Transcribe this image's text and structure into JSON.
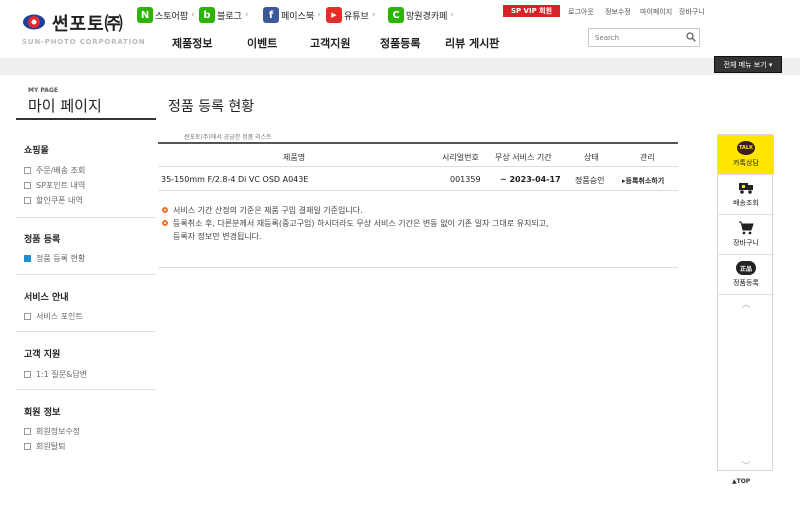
{
  "brand": {
    "name": "썬포토㈜",
    "sub": "SUN-PHOTO CORPORATION"
  },
  "social": [
    {
      "label": "스토어팜",
      "icon": "store-farm-icon",
      "glyph": "N",
      "color": "#2db400"
    },
    {
      "label": "블로그",
      "icon": "blog-icon",
      "glyph": "b",
      "color": "#2db400"
    },
    {
      "label": "페이스북",
      "icon": "facebook-icon",
      "glyph": "f",
      "color": "#3b5998"
    },
    {
      "label": "유튜브",
      "icon": "youtube-icon",
      "glyph": "▶",
      "color": "#e52d27"
    },
    {
      "label": "망원경카페",
      "icon": "cafe-icon",
      "glyph": "C",
      "color": "#2db400"
    }
  ],
  "top_links": {
    "vip": "SP VIP 회원",
    "login": "로그아웃",
    "info_edit": "정보수정",
    "mypage": "마이페이지",
    "cart": "장바구니"
  },
  "gnb": [
    "제품정보",
    "이벤트",
    "고객지원",
    "정품등록",
    "리뷰 게시판"
  ],
  "search": {
    "placeholder": "Search"
  },
  "all_menu": "전체 메뉴 보기 ▾",
  "mypage": {
    "small": "MY PAGE",
    "title": "마이 페이지"
  },
  "page_title": "정품 등록 현황",
  "sidebar": [
    {
      "head": "쇼핑몰",
      "items": [
        {
          "label": "주문/배송 조회",
          "active": false
        },
        {
          "label": "SP포인트 내역",
          "active": false
        },
        {
          "label": "할인쿠폰 내역",
          "active": false
        }
      ]
    },
    {
      "head": "정품 등록",
      "items": [
        {
          "label": "정품 등록 현황",
          "active": true
        }
      ]
    },
    {
      "head": "서비스 안내",
      "items": [
        {
          "label": "서비스 포인트",
          "active": false
        }
      ]
    },
    {
      "head": "고객 지원",
      "items": [
        {
          "label": "1:1 질문&답변",
          "active": false
        }
      ]
    },
    {
      "head": "회원 정보",
      "items": [
        {
          "label": "회원정보수정",
          "active": false
        },
        {
          "label": "회원탈퇴",
          "active": false
        }
      ]
    }
  ],
  "table": {
    "caption": "썬포토(주)에서 공급한 정품 리스트",
    "headers": [
      "제품명",
      "시리얼번호",
      "무상 서비스 기간",
      "상태",
      "관리"
    ],
    "rows": [
      {
        "product": "35-150mm F/2.8-4 Di VC OSD A043E",
        "serial": "001359",
        "period": "~ 2023-04-17",
        "status": "정품승인",
        "action": "▸등록취소하기"
      }
    ]
  },
  "notes": [
    "서비스 기간 산정의 기준은 제품 구입 결제일 기준입니다.",
    "등록취소 후, 다른분께서 재등록(중고구입) 하시더라도 무상 서비스 기간은 변동 없이 기존 일자 그대로 유지되고,",
    "등록자 정보만 변경됩니다."
  ],
  "quick_menu": {
    "kakao": "카톡상담",
    "talk": "TALK",
    "delivery": "배송조회",
    "cart": "장바구니",
    "genuine": "정품등록",
    "genuine_badge": "正品",
    "up": "︿",
    "down": "﹀"
  },
  "top_button": "▲TOP"
}
